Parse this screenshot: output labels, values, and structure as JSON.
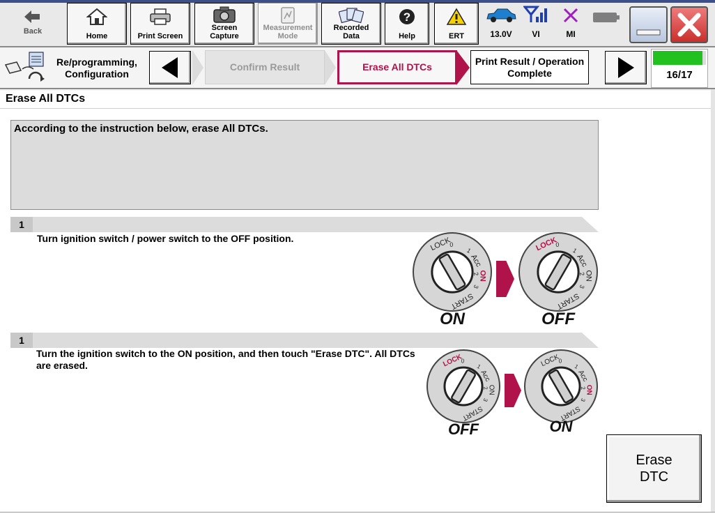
{
  "toolbar": {
    "back_label": "Back",
    "home_label": "Home",
    "print_screen_label": "Print Screen",
    "screen_capture_label": "Screen Capture",
    "measurement_mode_label": "Measurement Mode",
    "recorded_data_label": "Recorded Data",
    "help_label": "Help",
    "ert_label": "ERT",
    "voltage_label": "13.0V",
    "vi_label": "VI",
    "mi_label": "MI"
  },
  "stepbar": {
    "section_label": "Re/programming, Configuration",
    "step_confirm": "Confirm Result",
    "step_erase": "Erase All DTCs",
    "step_print": "Print Result / Operation Complete",
    "progress_text": "16/17",
    "progress_fraction": 0.94
  },
  "page": {
    "title": "Erase All DTCs",
    "instruction": "According to the instruction below, erase All DTCs."
  },
  "steps": [
    {
      "number": "1",
      "text": "Turn ignition switch / power switch to the OFF position.",
      "from_label": "ON",
      "to_label": "OFF"
    },
    {
      "number": "1",
      "text": "Turn the ignition switch to the ON position, and then touch \"Erase DTC\". All DTCs are erased.",
      "from_label": "OFF",
      "to_label": "ON"
    }
  ],
  "key_labels": {
    "lock": "LOCK",
    "acc": "Acc",
    "on": "ON",
    "start": "START",
    "pos0": "0",
    "pos1": "1",
    "pos2": "2",
    "pos3": "3"
  },
  "erase_button": {
    "line1": "Erase",
    "line2": "DTC"
  },
  "colors": {
    "accent": "#b0124a",
    "progress": "#21c21f",
    "instruction_bg": "#dcdcdc"
  }
}
